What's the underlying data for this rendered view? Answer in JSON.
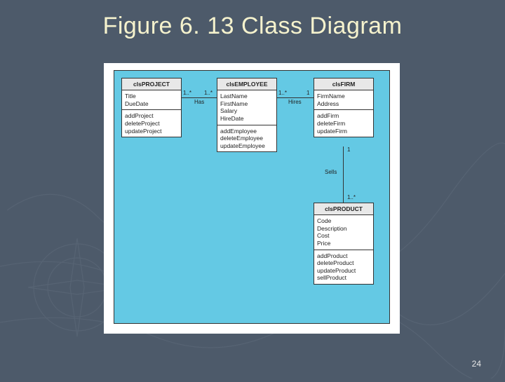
{
  "title": "Figure 6. 13 Class Diagram",
  "page_number": "24",
  "classes": {
    "project": {
      "name": "clsPROJECT",
      "attributes": [
        "Title",
        "DueDate"
      ],
      "operations": [
        "addProject",
        "deleteProject",
        "updateProject"
      ]
    },
    "employee": {
      "name": "clsEMPLOYEE",
      "attributes": [
        "LastName",
        "FirstName",
        "Salary",
        "HireDate"
      ],
      "operations": [
        "addEmployee",
        "deleteEmployee",
        "updateEmployee"
      ]
    },
    "firm": {
      "name": "clsFIRM",
      "attributes": [
        "FirmName",
        "Address"
      ],
      "operations": [
        "addFirm",
        "deleteFirm",
        "updateFirm"
      ]
    },
    "product": {
      "name": "clsPRODUCT",
      "attributes": [
        "Code",
        "Description",
        "Cost",
        "Price"
      ],
      "operations": [
        "addProduct",
        "deleteProduct",
        "updateProduct",
        "sellProduct"
      ]
    }
  },
  "relationships": {
    "has": {
      "label": "Has",
      "left_mult": "1..*",
      "right_mult": "1..*"
    },
    "hires": {
      "label": "Hires",
      "left_mult": "1..*",
      "right_mult": "1"
    },
    "sells": {
      "label": "Sells",
      "top_mult": "1",
      "bottom_mult": "1..*"
    }
  }
}
